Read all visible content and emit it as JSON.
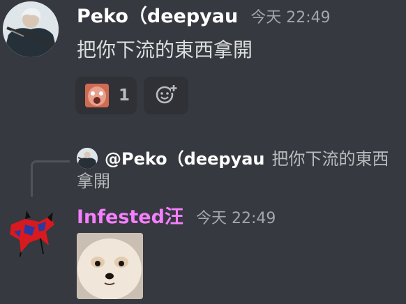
{
  "messages": [
    {
      "username": "Peko（deepyau",
      "timestamp": "今天 22:49",
      "content": "把你下流的東西拿開",
      "reactions": [
        {
          "emoji": "pogchamp-face",
          "count": "1"
        }
      ],
      "add_reaction_icon": "add-emoji-icon"
    },
    {
      "reply": {
        "mention": "@Peko（deepyau",
        "snippet": "把你下流的東西拿開"
      },
      "username": "Infested汪",
      "timestamp": "今天 22:49",
      "attachment": "pomeranian-dog-photo"
    }
  ],
  "colors": {
    "background": "#36393f",
    "username_primary": "#ffffff",
    "username_role": "#f47fff",
    "timestamp": "#a3a6aa",
    "reaction_bg": "#2f3136"
  }
}
